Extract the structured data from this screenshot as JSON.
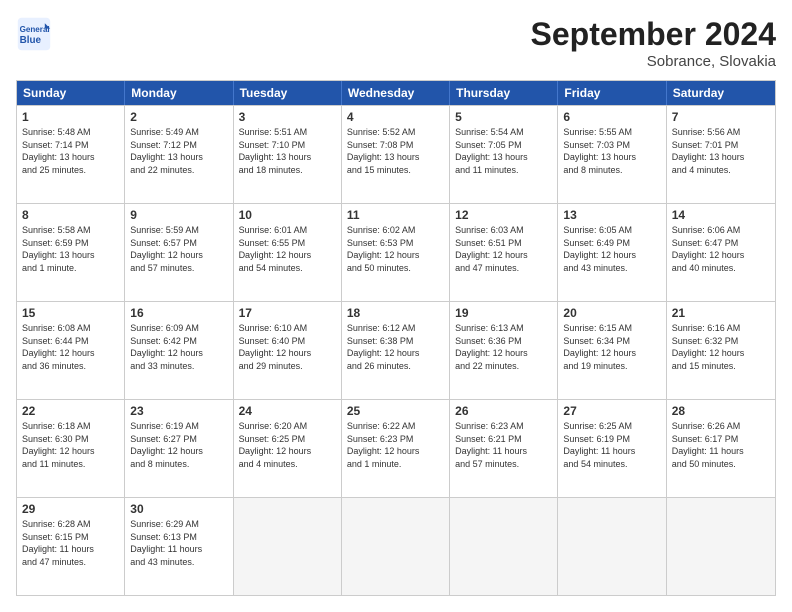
{
  "logo": {
    "text_general": "General",
    "text_blue": "Blue"
  },
  "header": {
    "month_title": "September 2024",
    "subtitle": "Sobrance, Slovakia"
  },
  "weekdays": [
    "Sunday",
    "Monday",
    "Tuesday",
    "Wednesday",
    "Thursday",
    "Friday",
    "Saturday"
  ],
  "rows": [
    [
      {
        "day": "1",
        "info": "Sunrise: 5:48 AM\nSunset: 7:14 PM\nDaylight: 13 hours\nand 25 minutes."
      },
      {
        "day": "2",
        "info": "Sunrise: 5:49 AM\nSunset: 7:12 PM\nDaylight: 13 hours\nand 22 minutes."
      },
      {
        "day": "3",
        "info": "Sunrise: 5:51 AM\nSunset: 7:10 PM\nDaylight: 13 hours\nand 18 minutes."
      },
      {
        "day": "4",
        "info": "Sunrise: 5:52 AM\nSunset: 7:08 PM\nDaylight: 13 hours\nand 15 minutes."
      },
      {
        "day": "5",
        "info": "Sunrise: 5:54 AM\nSunset: 7:05 PM\nDaylight: 13 hours\nand 11 minutes."
      },
      {
        "day": "6",
        "info": "Sunrise: 5:55 AM\nSunset: 7:03 PM\nDaylight: 13 hours\nand 8 minutes."
      },
      {
        "day": "7",
        "info": "Sunrise: 5:56 AM\nSunset: 7:01 PM\nDaylight: 13 hours\nand 4 minutes."
      }
    ],
    [
      {
        "day": "8",
        "info": "Sunrise: 5:58 AM\nSunset: 6:59 PM\nDaylight: 13 hours\nand 1 minute."
      },
      {
        "day": "9",
        "info": "Sunrise: 5:59 AM\nSunset: 6:57 PM\nDaylight: 12 hours\nand 57 minutes."
      },
      {
        "day": "10",
        "info": "Sunrise: 6:01 AM\nSunset: 6:55 PM\nDaylight: 12 hours\nand 54 minutes."
      },
      {
        "day": "11",
        "info": "Sunrise: 6:02 AM\nSunset: 6:53 PM\nDaylight: 12 hours\nand 50 minutes."
      },
      {
        "day": "12",
        "info": "Sunrise: 6:03 AM\nSunset: 6:51 PM\nDaylight: 12 hours\nand 47 minutes."
      },
      {
        "day": "13",
        "info": "Sunrise: 6:05 AM\nSunset: 6:49 PM\nDaylight: 12 hours\nand 43 minutes."
      },
      {
        "day": "14",
        "info": "Sunrise: 6:06 AM\nSunset: 6:47 PM\nDaylight: 12 hours\nand 40 minutes."
      }
    ],
    [
      {
        "day": "15",
        "info": "Sunrise: 6:08 AM\nSunset: 6:44 PM\nDaylight: 12 hours\nand 36 minutes."
      },
      {
        "day": "16",
        "info": "Sunrise: 6:09 AM\nSunset: 6:42 PM\nDaylight: 12 hours\nand 33 minutes."
      },
      {
        "day": "17",
        "info": "Sunrise: 6:10 AM\nSunset: 6:40 PM\nDaylight: 12 hours\nand 29 minutes."
      },
      {
        "day": "18",
        "info": "Sunrise: 6:12 AM\nSunset: 6:38 PM\nDaylight: 12 hours\nand 26 minutes."
      },
      {
        "day": "19",
        "info": "Sunrise: 6:13 AM\nSunset: 6:36 PM\nDaylight: 12 hours\nand 22 minutes."
      },
      {
        "day": "20",
        "info": "Sunrise: 6:15 AM\nSunset: 6:34 PM\nDaylight: 12 hours\nand 19 minutes."
      },
      {
        "day": "21",
        "info": "Sunrise: 6:16 AM\nSunset: 6:32 PM\nDaylight: 12 hours\nand 15 minutes."
      }
    ],
    [
      {
        "day": "22",
        "info": "Sunrise: 6:18 AM\nSunset: 6:30 PM\nDaylight: 12 hours\nand 11 minutes."
      },
      {
        "day": "23",
        "info": "Sunrise: 6:19 AM\nSunset: 6:27 PM\nDaylight: 12 hours\nand 8 minutes."
      },
      {
        "day": "24",
        "info": "Sunrise: 6:20 AM\nSunset: 6:25 PM\nDaylight: 12 hours\nand 4 minutes."
      },
      {
        "day": "25",
        "info": "Sunrise: 6:22 AM\nSunset: 6:23 PM\nDaylight: 12 hours\nand 1 minute."
      },
      {
        "day": "26",
        "info": "Sunrise: 6:23 AM\nSunset: 6:21 PM\nDaylight: 11 hours\nand 57 minutes."
      },
      {
        "day": "27",
        "info": "Sunrise: 6:25 AM\nSunset: 6:19 PM\nDaylight: 11 hours\nand 54 minutes."
      },
      {
        "day": "28",
        "info": "Sunrise: 6:26 AM\nSunset: 6:17 PM\nDaylight: 11 hours\nand 50 minutes."
      }
    ],
    [
      {
        "day": "29",
        "info": "Sunrise: 6:28 AM\nSunset: 6:15 PM\nDaylight: 11 hours\nand 47 minutes."
      },
      {
        "day": "30",
        "info": "Sunrise: 6:29 AM\nSunset: 6:13 PM\nDaylight: 11 hours\nand 43 minutes."
      },
      {
        "day": "",
        "info": ""
      },
      {
        "day": "",
        "info": ""
      },
      {
        "day": "",
        "info": ""
      },
      {
        "day": "",
        "info": ""
      },
      {
        "day": "",
        "info": ""
      }
    ]
  ]
}
